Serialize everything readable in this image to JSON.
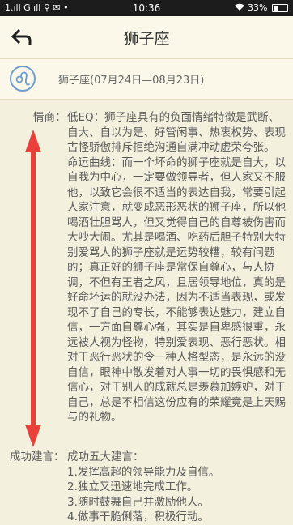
{
  "status_bar": {
    "left_text": "1.ıll G ıll ⚲ ✉ •",
    "time": "10:36",
    "battery": "33%",
    "battery_level": 0.33
  },
  "header": {
    "title": "狮子座"
  },
  "info": {
    "date_range": "狮子座(07月24日—08月23日)"
  },
  "sections": {
    "eq": {
      "label": "情商：",
      "paragraph1": "低EQ：狮子座具有的负面情绪特徵是武断、自大、自以为是、好管闲事、热衷权势、表现古怪骄傲排斥拒绝沟通自满冲动虚荣夸张。",
      "paragraph2": "命运曲线：而一个坏命的狮子座就是自大，以自我为中心，一定要做领导者，但人家又不服他，以致它会很不适当的表达自我，常要引起人家注意，就变成恶形恶状的狮子座，所以他喝酒壮胆骂人，但又觉得自己的自尊被伤害而大吵大闹。尤其是喝酒、吃药后胆子特别大特别爱骂人的狮子座就是运势较糟，较有问题的；真正好的狮子座是常保自尊心，与人协调，不但有王者之风，且居领导地位，真的是好命坏运的就没办法，因为不适当表现，或发现不了自己的专长，不能够表达魅力，建立自信，一方面自尊心强，其实是自卑感很重，永远被人视为怪物，特别爱表现、恶行恶状。相对于恶行恶状的令一种人格型态，是永远的没自信，眼神中散发着对人事一切的畏惧感和无信心，对于别人的成就总是羡慕加嫉妒，对于自己，总是不相信这份应有的荣耀竟是上天赐与的礼物。"
    },
    "advice": {
      "label": "成功建言：",
      "intro": "成功五大建言：",
      "items": [
        "1.发挥高超的领导能力及自信。",
        "2.独立又迅速地完成工作。",
        "3.随时鼓舞自己并激励他人。",
        "4.做事干脆俐落，积极行动。"
      ]
    }
  },
  "colors": {
    "background": "#f4f0de",
    "accent_arrow": "#e8403a",
    "icon_blue": "#6d9ed3"
  },
  "icons": {
    "back": "back-arrow-icon",
    "zodiac": "leo-icon"
  }
}
